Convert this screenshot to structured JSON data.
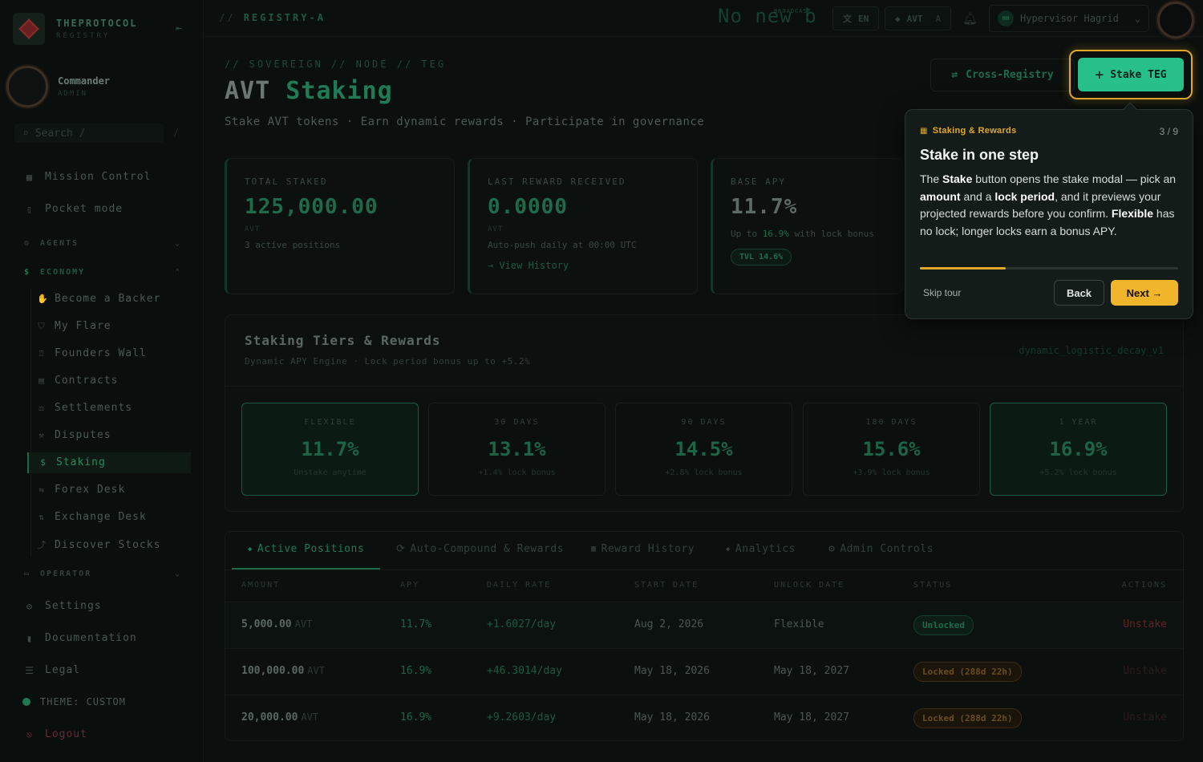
{
  "brand": {
    "name": "THEPROTOCOL",
    "sub": "REGISTRY"
  },
  "user": {
    "name": "Commander",
    "role": "ADMIN"
  },
  "search": {
    "placeholder": "Search",
    "shortcut": "/"
  },
  "nav": {
    "mission_control": "Mission Control",
    "pocket_mode": "Pocket mode",
    "agents": "AGENTS",
    "economy": "ECONOMY",
    "economy_items": [
      {
        "label": "Become a Backer",
        "icon": "hands-icon"
      },
      {
        "label": "My Flare",
        "icon": "shield-icon"
      },
      {
        "label": "Founders Wall",
        "icon": "trophy-icon"
      },
      {
        "label": "Contracts",
        "icon": "document-icon"
      },
      {
        "label": "Settlements",
        "icon": "scale-icon"
      },
      {
        "label": "Disputes",
        "icon": "gavel-icon"
      },
      {
        "label": "Staking",
        "icon": "dollar-icon"
      },
      {
        "label": "Forex Desk",
        "icon": "exchange-icon"
      },
      {
        "label": "Exchange Desk",
        "icon": "arrows-icon"
      },
      {
        "label": "Discover Stocks",
        "icon": "chart-icon"
      }
    ],
    "operator": "OPERATOR",
    "settings": "Settings",
    "documentation": "Documentation",
    "legal": "Legal",
    "theme": "THEME: CUSTOM",
    "logout": "Logout"
  },
  "topbar": {
    "breadcrumb_prefix": "//",
    "breadcrumb": "REGISTRY-A",
    "ticker": "No new b",
    "ticker_badge": "BROADCAST",
    "lang": "EN",
    "token": "AVT",
    "token_suffix": "A",
    "operator_initials": "HH",
    "operator_name": "Hypervisor Hagrid"
  },
  "header": {
    "crumb": "// SOVEREIGN // NODE // TEG",
    "title_main": "AVT",
    "title_accent": "Staking",
    "subtitle": "Stake AVT tokens · Earn dynamic rewards · Participate in governance",
    "cross_registry": "Cross-Registry",
    "stake_button": "Stake TEG"
  },
  "stats": {
    "total_staked": {
      "label": "TOTAL STAKED",
      "value": "125,000.00",
      "unit": "AVT",
      "note": "3 active positions"
    },
    "last_reward": {
      "label": "LAST REWARD RECEIVED",
      "value": "0.0000",
      "unit": "AVT",
      "note": "Auto-push daily at 00:00 UTC",
      "link": "→ View History"
    },
    "base_apy": {
      "label": "BASE APY",
      "value": "11.7%",
      "note_prefix": "Up to",
      "note_value": "16.9%",
      "note_suffix": "with lock bonus",
      "tvl": "TVL 14.6%"
    }
  },
  "tiers": {
    "title": "Staking Tiers & Rewards",
    "subtitle": "Dynamic APY Engine · Lock period bonus up to +5.2%",
    "model": "dynamic_logistic_decay_v1",
    "items": [
      {
        "label": "FLEXIBLE",
        "apy": "11.7%",
        "note": "Unstake anytime"
      },
      {
        "label": "30 DAYS",
        "apy": "13.1%",
        "note": "+1.4% lock bonus"
      },
      {
        "label": "90 DAYS",
        "apy": "14.5%",
        "note": "+2.8% lock bonus"
      },
      {
        "label": "180 DAYS",
        "apy": "15.6%",
        "note": "+3.9% lock bonus"
      },
      {
        "label": "1 YEAR",
        "apy": "16.9%",
        "note": "+5.2% lock bonus"
      }
    ]
  },
  "positions": {
    "tabs": [
      "Active Positions",
      "Auto-Compound & Rewards",
      "Reward History",
      "Analytics",
      "Admin Controls"
    ],
    "columns": [
      "AMOUNT",
      "APY",
      "DAILY RATE",
      "START DATE",
      "UNLOCK DATE",
      "STATUS",
      "ACTIONS"
    ],
    "rows": [
      {
        "amount": "5,000.00",
        "unit": "AVT",
        "apy": "11.7%",
        "rate": "+1.6027/day",
        "start": "Aug 2, 2026",
        "unlock": "Flexible",
        "status": "Unlocked",
        "action": "Unstake"
      },
      {
        "amount": "100,000.00",
        "unit": "AVT",
        "apy": "16.9%",
        "rate": "+46.3014/day",
        "start": "May 18, 2026",
        "unlock": "May 18, 2027",
        "status": "Locked (288d 22h)",
        "action": "Unstake"
      },
      {
        "amount": "20,000.00",
        "unit": "AVT",
        "apy": "16.9%",
        "rate": "+9.2603/day",
        "start": "May 18, 2026",
        "unlock": "May 18, 2027",
        "status": "Locked (288d 22h)",
        "action": "Unstake"
      }
    ]
  },
  "tour": {
    "category": "Staking & Rewards",
    "step": "3 / 9",
    "progress": 0.333,
    "title": "Stake in one step",
    "body_1": "The ",
    "body_stake": "Stake",
    "body_2": " button opens the stake modal — pick an ",
    "body_amount": "amount",
    "body_3": " and a ",
    "body_lock": "lock period",
    "body_4": ", and it previews your projected rewards before you confirm. ",
    "body_flexible": "Flexible",
    "body_5": " has no lock; longer locks earn a bonus APY.",
    "skip": "Skip tour",
    "back": "Back",
    "next": "Next →"
  }
}
